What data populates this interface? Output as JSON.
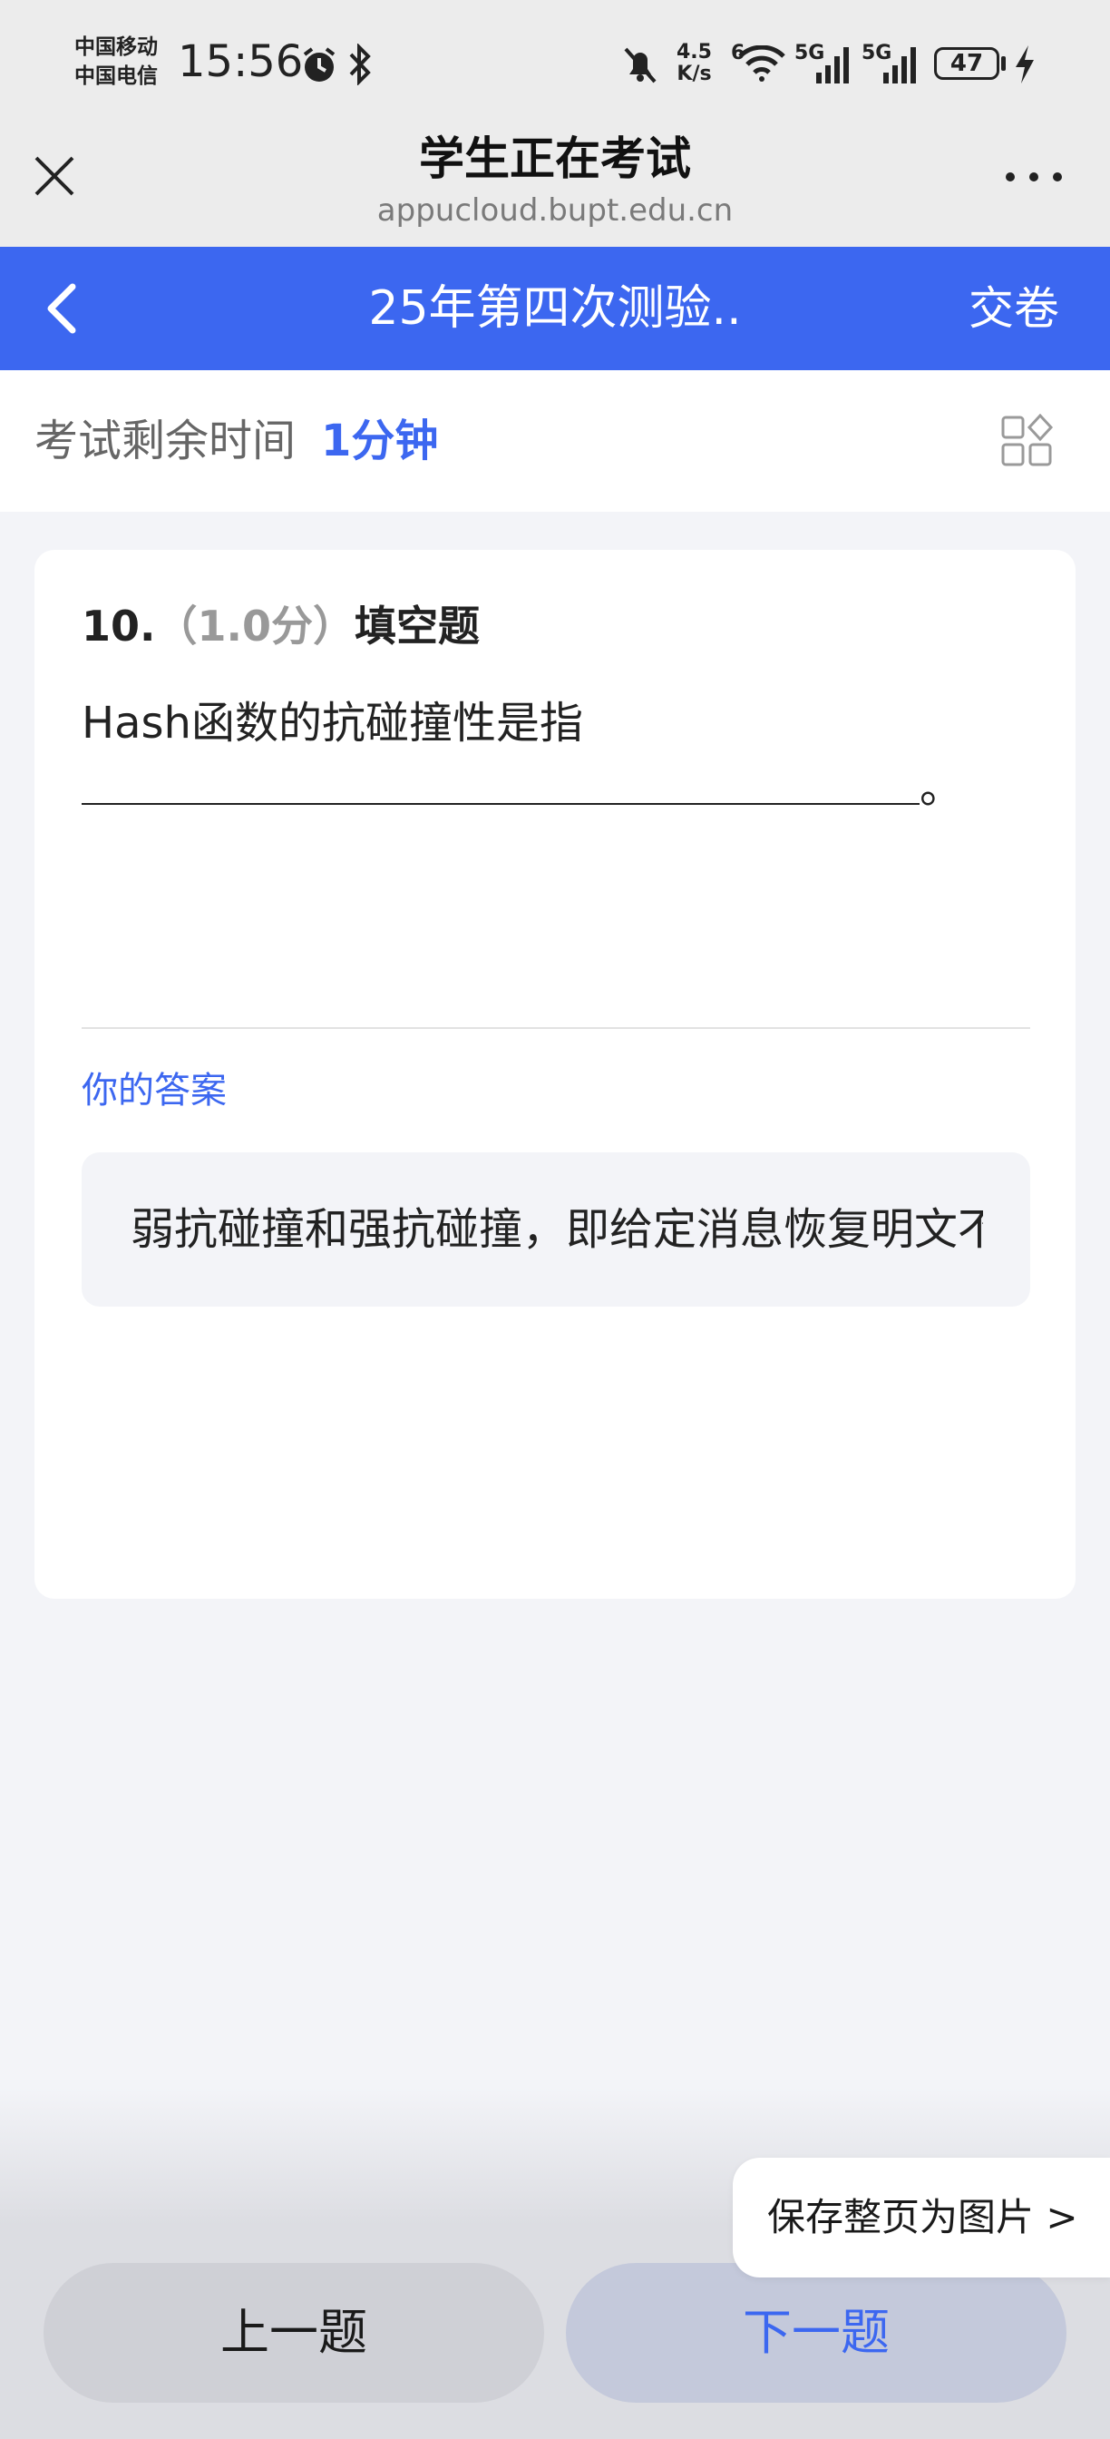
{
  "status_bar": {
    "carrier_1": "中国移动",
    "carrier_2": "中国电信",
    "time": "15:56",
    "net_speed_value": "4.5",
    "net_speed_unit": "K/s",
    "wifi_badge": "6",
    "signal_1": "5G",
    "signal_2": "5G",
    "battery": "47"
  },
  "browser": {
    "title": "学生正在考试",
    "url": "appucloud.bupt.edu.cn"
  },
  "nav": {
    "title": "25年第四次测验..",
    "submit": "交卷"
  },
  "timer": {
    "label": "考试剩余时间",
    "value": "1分钟"
  },
  "question": {
    "number": "10.",
    "score": "（1.0分）",
    "type": "填空题",
    "text": "Hash函数的抗碰撞性是指",
    "end_mark": "。",
    "answer_label": "你的答案",
    "answer": "弱抗碰撞和强抗碰撞，即给定消息恢复明文不"
  },
  "bottom": {
    "prev": "上一题",
    "next": "下一题",
    "save_image": "保存整页为图片 >"
  },
  "colors": {
    "accent": "#3c67f0",
    "background": "#f3f4f8"
  }
}
